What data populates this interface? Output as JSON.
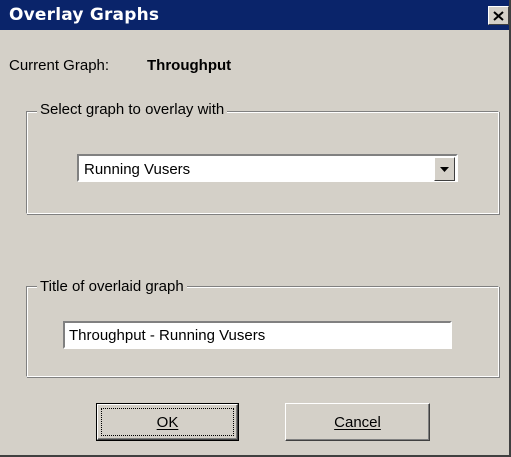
{
  "window": {
    "title": "Overlay Graphs",
    "close_icon": "close-icon"
  },
  "current_graph": {
    "label": "Current Graph:",
    "value": "Throughput"
  },
  "overlay_group": {
    "legend": "Select graph to overlay with",
    "selected": "Running Vusers",
    "arrow_icon": "chevron-down-icon"
  },
  "title_group": {
    "legend": "Title of overlaid graph",
    "value": "Throughput - Running Vusers"
  },
  "buttons": {
    "ok": "OK",
    "cancel": "Cancel"
  },
  "colors": {
    "titlebar": "#0a246a",
    "face": "#d4d0c8"
  }
}
